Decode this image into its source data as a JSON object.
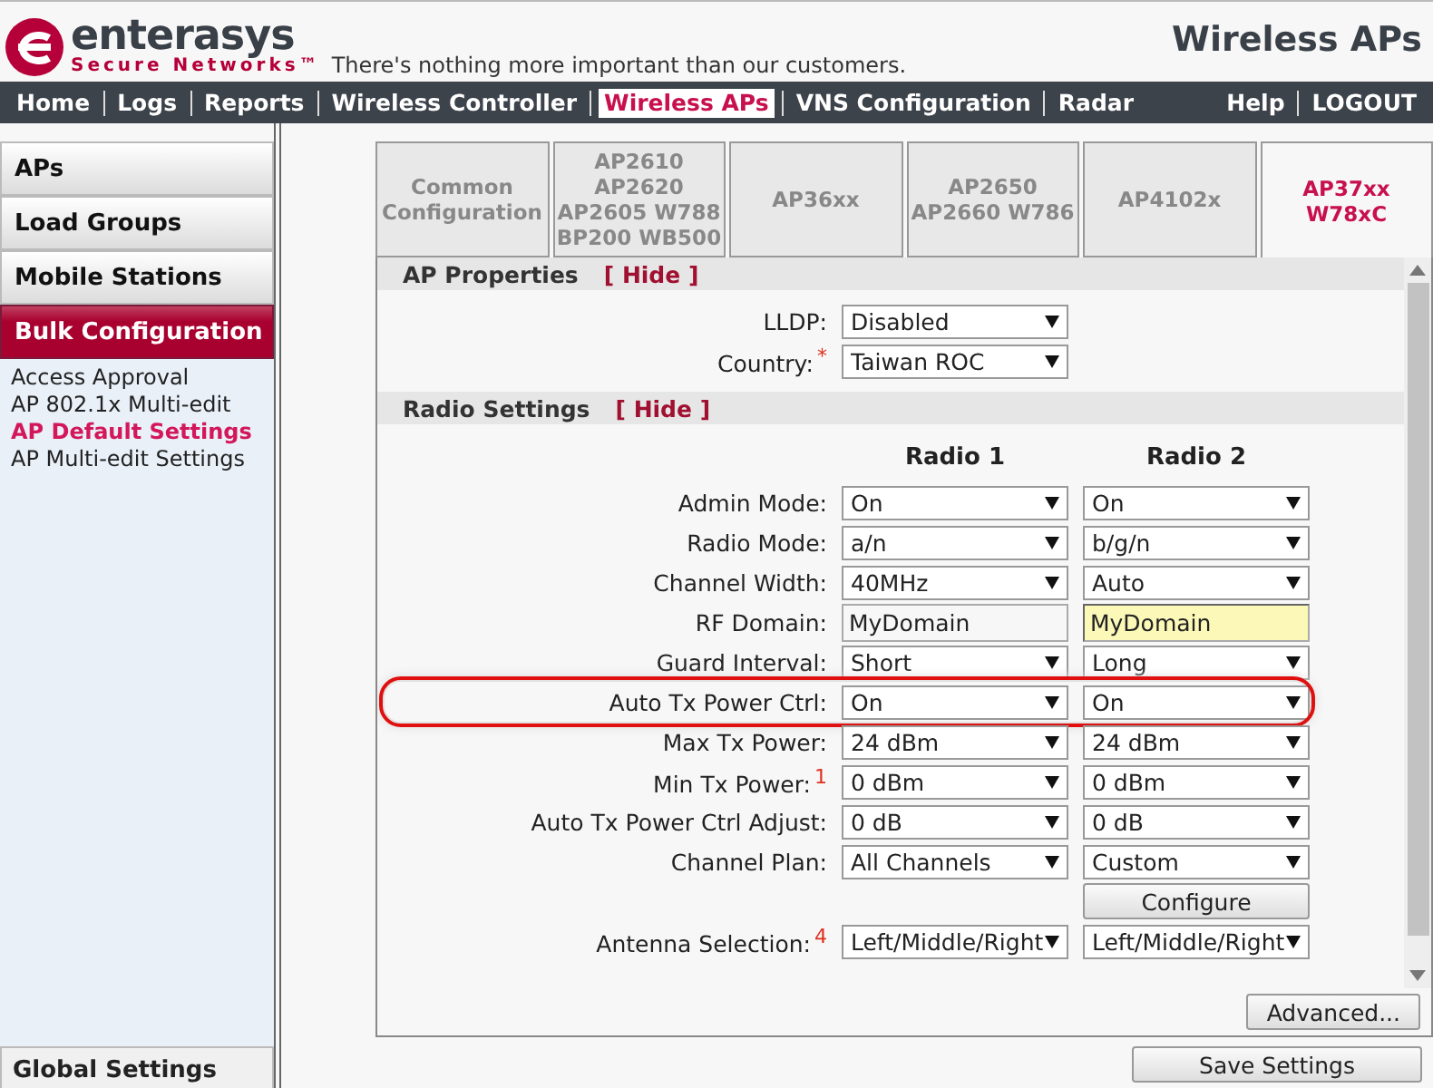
{
  "header": {
    "brand": "enterasys",
    "brand_sub": "Secure Networks™",
    "tagline": "There's nothing more important than our customers.",
    "title": "Wireless APs"
  },
  "nav": {
    "items": [
      {
        "label": "Home",
        "selected": false
      },
      {
        "label": "Logs",
        "selected": false
      },
      {
        "label": "Reports",
        "selected": false
      },
      {
        "label": "Wireless Controller",
        "selected": false
      },
      {
        "label": "Wireless APs",
        "selected": true
      },
      {
        "label": "VNS Configuration",
        "selected": false
      },
      {
        "label": "Radar",
        "selected": false
      }
    ],
    "right": [
      "Help",
      "LOGOUT"
    ]
  },
  "sidebar": {
    "sections": [
      {
        "label": "APs",
        "selected": false
      },
      {
        "label": "Load Groups",
        "selected": false
      },
      {
        "label": "Mobile Stations",
        "selected": false
      },
      {
        "label": "Bulk Configuration",
        "selected": true,
        "children": [
          {
            "label": "Access Approval",
            "selected": false
          },
          {
            "label": "AP 802.1x Multi-edit",
            "selected": false
          },
          {
            "label": "AP Default Settings",
            "selected": true
          },
          {
            "label": "AP Multi-edit Settings",
            "selected": false
          }
        ]
      }
    ],
    "footer": "Global Settings"
  },
  "tabs": [
    {
      "lines": [
        "Common",
        "Configuration"
      ],
      "selected": false
    },
    {
      "lines": [
        "AP2610",
        "AP2620",
        "AP2605 W788",
        "BP200 WB500"
      ],
      "selected": false
    },
    {
      "lines": [
        "AP36xx"
      ],
      "selected": false
    },
    {
      "lines": [
        "AP2650",
        "AP2660 W786"
      ],
      "selected": false
    },
    {
      "lines": [
        "AP4102x"
      ],
      "selected": false
    },
    {
      "lines": [
        "AP37xx",
        "W78xC"
      ],
      "selected": true
    }
  ],
  "ap_properties": {
    "title": "AP Properties",
    "toggle": "[ Hide ]",
    "fields": [
      {
        "label": "LLDP:",
        "value": "Disabled"
      },
      {
        "label": "Country:",
        "note": "*",
        "value": "Taiwan ROC"
      }
    ]
  },
  "radio_settings": {
    "title": "Radio Settings",
    "toggle": "[ Hide ]",
    "columns": [
      "Radio 1",
      "Radio 2"
    ],
    "rows": [
      {
        "label": "Admin Mode:",
        "highlighted": false,
        "cells": [
          {
            "kind": "select",
            "value": "On"
          },
          {
            "kind": "select",
            "value": "On"
          }
        ]
      },
      {
        "label": "Radio Mode:",
        "highlighted": false,
        "cells": [
          {
            "kind": "select",
            "value": "a/n"
          },
          {
            "kind": "select",
            "value": "b/g/n"
          }
        ]
      },
      {
        "label": "Channel Width:",
        "highlighted": false,
        "cells": [
          {
            "kind": "select",
            "value": "40MHz"
          },
          {
            "kind": "select",
            "value": "Auto"
          }
        ]
      },
      {
        "label": "RF Domain:",
        "highlighted": false,
        "cells": [
          {
            "kind": "text",
            "value": "MyDomain",
            "focused": false
          },
          {
            "kind": "text",
            "value": "MyDomain",
            "focused": true
          }
        ]
      },
      {
        "label": "Guard Interval:",
        "highlighted": false,
        "cells": [
          {
            "kind": "select",
            "value": "Short"
          },
          {
            "kind": "select",
            "value": "Long"
          }
        ]
      },
      {
        "label": "Auto Tx Power Ctrl:",
        "highlighted": true,
        "cells": [
          {
            "kind": "select",
            "value": "On"
          },
          {
            "kind": "select",
            "value": "On"
          }
        ]
      },
      {
        "label": "Max Tx Power:",
        "highlighted": false,
        "cells": [
          {
            "kind": "select",
            "value": "24 dBm"
          },
          {
            "kind": "select",
            "value": "24 dBm"
          }
        ]
      },
      {
        "label": "Min Tx Power:",
        "note": "1",
        "highlighted": false,
        "cells": [
          {
            "kind": "select",
            "value": "0 dBm"
          },
          {
            "kind": "select",
            "value": "0 dBm"
          }
        ]
      },
      {
        "label": "Auto Tx Power Ctrl Adjust:",
        "highlighted": false,
        "cells": [
          {
            "kind": "select",
            "value": "0 dB"
          },
          {
            "kind": "select",
            "value": "0 dB"
          }
        ]
      },
      {
        "label": "Channel Plan:",
        "highlighted": false,
        "cells": [
          {
            "kind": "select",
            "value": "All Channels"
          },
          {
            "kind": "select",
            "value": "Custom"
          }
        ]
      },
      {
        "highlighted": false,
        "cells": [
          {
            "kind": "empty"
          },
          {
            "kind": "button",
            "value": "Configure"
          }
        ]
      },
      {
        "label": "Antenna Selection:",
        "note": "4",
        "highlighted": false,
        "cells": [
          {
            "kind": "select",
            "value": "Left/Middle/Right"
          },
          {
            "kind": "select",
            "value": "Left/Middle/Right"
          }
        ]
      }
    ]
  },
  "advanced_button": "Advanced...",
  "save_button": "Save Settings"
}
